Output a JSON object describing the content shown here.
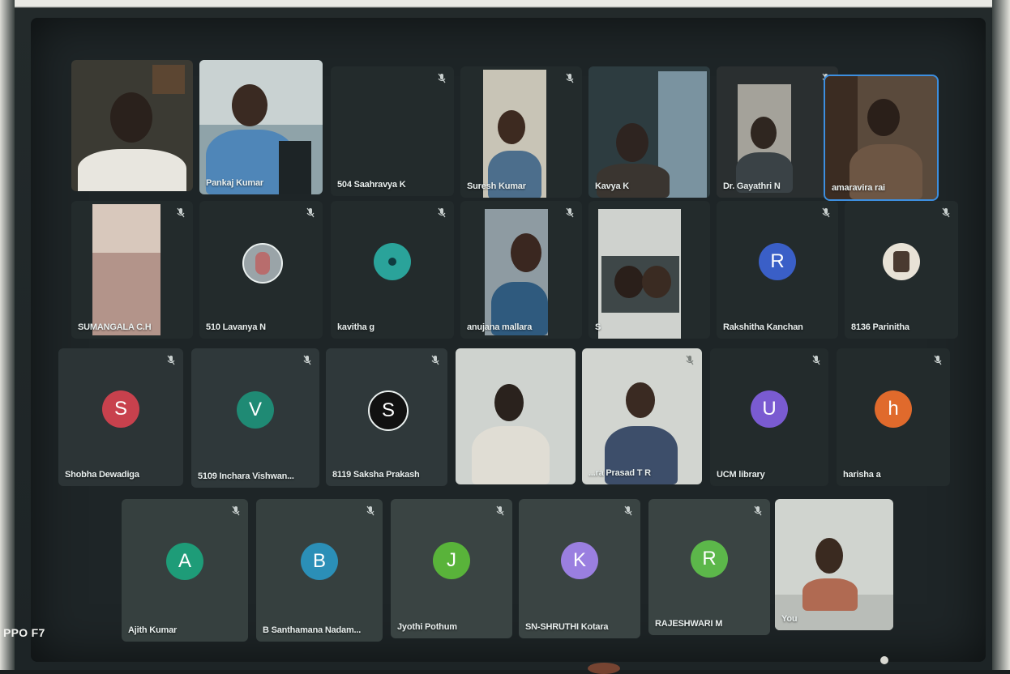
{
  "meeting": {
    "tiles": [
      {
        "name": "",
        "avatar": "",
        "color": "",
        "type": "video"
      },
      {
        "name": "Pankaj Kumar",
        "avatar": "",
        "color": "",
        "type": "video"
      },
      {
        "name": "504 Saahravya K",
        "avatar": "",
        "color": "",
        "type": "blank"
      },
      {
        "name": "Suresh Kumar",
        "avatar": "",
        "color": "",
        "type": "video"
      },
      {
        "name": "Kavya K",
        "avatar": "",
        "color": "",
        "type": "video"
      },
      {
        "name": "Dr. Gayathri N",
        "avatar": "",
        "color": "",
        "type": "video"
      },
      {
        "name": "amaravira rai",
        "avatar": "",
        "color": "",
        "type": "video",
        "active": true
      },
      {
        "name": "SUMANGALA C.H",
        "avatar": "",
        "color": "",
        "type": "video"
      },
      {
        "name": "510 Lavanya N",
        "avatar": "",
        "color": "#9aa4a8",
        "type": "photo-avatar"
      },
      {
        "name": "kavitha g",
        "avatar": "",
        "color": "#2aa39a",
        "type": "photo-avatar"
      },
      {
        "name": "anujana mallara",
        "avatar": "",
        "color": "",
        "type": "video"
      },
      {
        "name": "S",
        "avatar": "",
        "color": "",
        "type": "video"
      },
      {
        "name": "Rakshitha Kanchan",
        "avatar": "R",
        "color": "#3a5fc7",
        "type": "letter"
      },
      {
        "name": "8136 Parinitha",
        "avatar": "",
        "color": "#e8e2d6",
        "type": "photo-avatar"
      },
      {
        "name": "Shobha Dewadiga",
        "avatar": "S",
        "color": "#c8414d",
        "type": "letter"
      },
      {
        "name": "5109 Inchara Vishwan...",
        "avatar": "V",
        "color": "#1f8a74",
        "type": "letter"
      },
      {
        "name": "8119 Saksha Prakash",
        "avatar": "S",
        "color": "#111111",
        "type": "letter"
      },
      {
        "name": "",
        "avatar": "",
        "color": "",
        "type": "video"
      },
      {
        "name": "...ra Prasad T R",
        "avatar": "",
        "color": "",
        "type": "video"
      },
      {
        "name": "UCM library",
        "avatar": "U",
        "color": "#7a5bd1",
        "type": "letter"
      },
      {
        "name": "harisha a",
        "avatar": "h",
        "color": "#e06a2c",
        "type": "letter"
      },
      {
        "name": "Ajith Kumar",
        "avatar": "A",
        "color": "#1e9c78",
        "type": "letter"
      },
      {
        "name": "B Santhamana Nadam...",
        "avatar": "B",
        "color": "#2b8fb7",
        "type": "letter"
      },
      {
        "name": "Jyothi Pothum",
        "avatar": "J",
        "color": "#59b33a",
        "type": "letter"
      },
      {
        "name": "SN-SHRUTHI Kotara",
        "avatar": "K",
        "color": "#9a7fe0",
        "type": "letter"
      },
      {
        "name": "RAJESHWARI M",
        "avatar": "R",
        "color": "#5cb74a",
        "type": "letter"
      },
      {
        "name": "You",
        "avatar": "",
        "color": "",
        "type": "video"
      }
    ]
  },
  "camera_watermark": "PPO F7",
  "icons": {
    "mic_muted": "mic-off-icon"
  }
}
